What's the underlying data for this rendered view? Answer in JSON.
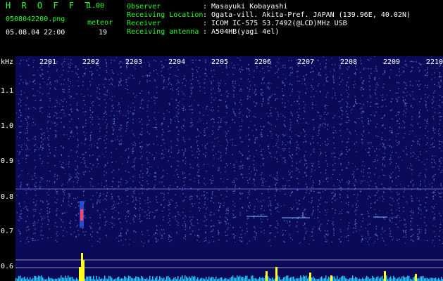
{
  "header": {
    "app_title": "H R O F F T",
    "version": "1.00",
    "file_name": "0508042200.png",
    "meteor_label": "meteor",
    "datetime": "05.08.04 22:00",
    "meteor_count": "19"
  },
  "info": [
    {
      "label": "Observer",
      "value": ": Masayuki Kobayashi"
    },
    {
      "label": "Receiving Location",
      "value": ": Ogata-vill. Akita-Pref. JAPAN (139.96E, 40.02N)"
    },
    {
      "label": "Receiver",
      "value": ": ICOM IC-575 53.7492(@LCD)MHz USB"
    },
    {
      "label": "Receiving antenna",
      "value": ": A504HB(yagi 4el)"
    }
  ],
  "spectrogram": {
    "unit_label": "kHz",
    "time_labels": [
      "2201",
      "2202",
      "2203",
      "2204",
      "2205",
      "2206",
      "2207",
      "2208",
      "2209",
      "2210"
    ],
    "freq_labels": [
      "1.1",
      "1.0",
      "0.9",
      "0.8",
      "0.7",
      "0.6"
    ],
    "colors": {
      "background": "#0a0a58",
      "speckle": "#6699ff",
      "meteor": "#ffff22",
      "meteor_core": "#ff4466",
      "baseline": "#22ccff",
      "grid": "#6666cc",
      "label": "#ffffff"
    }
  }
}
